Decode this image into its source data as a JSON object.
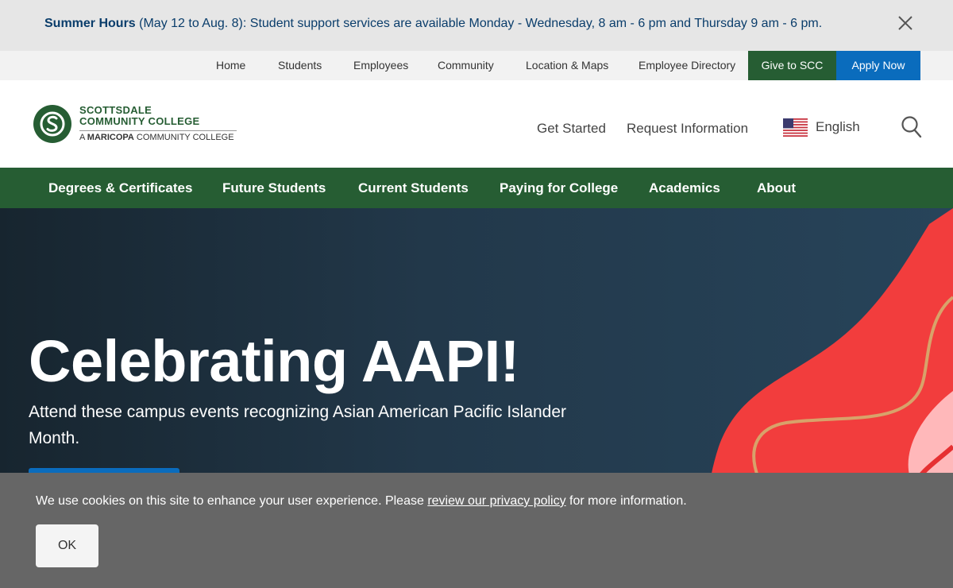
{
  "alert": {
    "title": "Summer Hours",
    "message": " (May 12 to Aug. 8): Student support services are available Monday - Wednesday, 8 am - 6 pm and Thursday 9 am - 6 pm.",
    "close_icon": "close-icon"
  },
  "utility_nav": {
    "items": [
      "Home",
      "Students",
      "Employees",
      "Community",
      "Location & Maps",
      "Employee Directory"
    ],
    "give_label": "Give to SCC",
    "apply_label": "Apply Now"
  },
  "header": {
    "logo": {
      "line1": "SCOTTSDALE",
      "line2": "COMMUNITY COLLEGE",
      "line3_prefix": "A ",
      "line3_bold": "MARICOPA",
      "line3_suffix": " COMMUNITY COLLEGE"
    },
    "links": [
      "Get Started",
      "Request Information"
    ],
    "language": "English",
    "search_icon": "search-icon"
  },
  "main_nav": {
    "items": [
      "Degrees & Certificates",
      "Future Students",
      "Current Students",
      "Paying for College",
      "Academics",
      "About"
    ]
  },
  "hero": {
    "title": "Celebrating AAPI!",
    "subtitle": "Attend these campus events recognizing Asian American Pacific Islander Month."
  },
  "cookie": {
    "text_before": "We use cookies on this site to enhance your user experience. Please ",
    "link_text": "review our privacy policy",
    "text_after": " for more information.",
    "ok_label": "OK"
  },
  "colors": {
    "brand_green": "#265d33",
    "brand_blue": "#0a6cbd",
    "alert_text": "#0a3d6b",
    "hero_accent": "#f23d3d"
  }
}
